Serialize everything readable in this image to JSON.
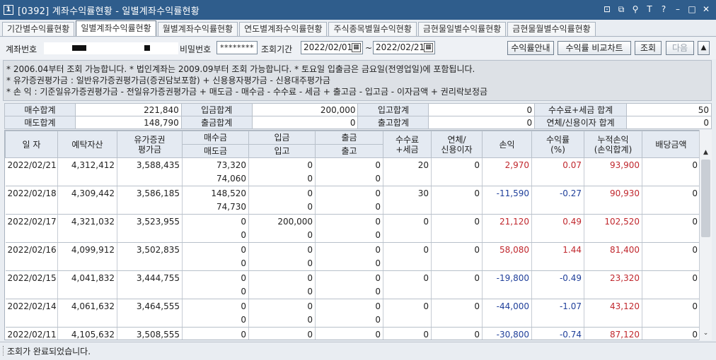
{
  "window": {
    "number": "1",
    "title": "[0392] 계좌수익률현황 - 일별계좌수익률현황",
    "icons": [
      "restore-window-icon",
      "copy-icon",
      "pin-icon",
      "font-icon",
      "help-icon",
      "minimize-icon",
      "maximize-icon",
      "close-icon"
    ],
    "icon_glyphs": [
      "⊡",
      "⧉",
      "⚲",
      "T",
      "?",
      "–",
      "□",
      "✕"
    ]
  },
  "tabs": [
    {
      "label": "기간별수익률현황",
      "active": false
    },
    {
      "label": "일별계좌수익률현황",
      "active": true
    },
    {
      "label": "월별계좌수익률현황",
      "active": false
    },
    {
      "label": "연도별계좌수익률현황",
      "active": false
    },
    {
      "label": "주식종목별월수익현황",
      "active": false
    },
    {
      "label": "금현물일별수익률현황",
      "active": false
    },
    {
      "label": "금현물월별수익률현황",
      "active": false
    }
  ],
  "search": {
    "account_label": "계좌번호",
    "password_label": "비밀번호",
    "password_value": "********",
    "period_label": "조회기간",
    "date_from": "2022/02/01",
    "date_sep": "~",
    "date_to": "2022/02/21",
    "calendar_glyph": "▦",
    "buttons": {
      "guide": "수익률안내",
      "compare": "수익률 비교차트",
      "query": "조회",
      "next": "다음",
      "collapse": "▲"
    }
  },
  "notes": [
    "* 2006.04부터 조회 가능합니다.   * 법인계좌는 2009.09부터 조회 가능합니다.   * 토요일 입출금은 금요일(전영업일)에 포함됩니다.",
    "* 유가증권평가금 : 일반유가증권평가금(증권담보포함) + 신용용자평가금 - 신용대주평가금",
    "* 손          익 : 기준일유가증권평가금 - 전일유가증권평가금 + 매도금 - 매수금 - 수수료 - 세금 + 출고금 - 입고금 - 이자금액 + 권리락보정금"
  ],
  "summary": {
    "row1": [
      {
        "label": "매수합계",
        "value": "221,840"
      },
      {
        "label": "입금합계",
        "value": "200,000"
      },
      {
        "label": "입고합계",
        "value": "0"
      },
      {
        "label": "수수료+세금 합계",
        "value": "50"
      }
    ],
    "row2": [
      {
        "label": "매도합계",
        "value": "148,790"
      },
      {
        "label": "출금합계",
        "value": "0"
      },
      {
        "label": "출고합계",
        "value": "0"
      },
      {
        "label": "연체/신용이자 합계",
        "value": "0"
      }
    ]
  },
  "grid": {
    "headers": {
      "date": "일 자",
      "deposit_assets": "예탁자산",
      "securities_eval_1": "유가증권",
      "securities_eval_2": "평가금",
      "buy": "매수금",
      "sell": "매도금",
      "deposit_in": "입금",
      "stock_in": "입고",
      "withdraw": "출금",
      "stock_out": "출고",
      "fee_1": "수수료",
      "fee_2": "+세금",
      "interest_1": "연체/",
      "interest_2": "신용이자",
      "pnl": "손익",
      "return_1": "수익률",
      "return_2": "(%)",
      "cum_pnl_1": "누적손익",
      "cum_pnl_2": "(손익합계)",
      "dividend": "배당금액"
    },
    "rows": [
      {
        "date": "2022/02/21",
        "assets": "4,312,412",
        "eval": "3,588,435",
        "buy": "73,320",
        "sell": "74,060",
        "dep": "0",
        "sin": "0",
        "wd": "0",
        "sout": "0",
        "fee": "20",
        "int": "0",
        "pnl": "2,970",
        "ret": "0.07",
        "cum": "93,900",
        "div": "0",
        "sign": "pos"
      },
      {
        "date": "2022/02/18",
        "assets": "4,309,442",
        "eval": "3,586,185",
        "buy": "148,520",
        "sell": "74,730",
        "dep": "0",
        "sin": "0",
        "wd": "0",
        "sout": "0",
        "fee": "30",
        "int": "0",
        "pnl": "-11,590",
        "ret": "-0.27",
        "cum": "90,930",
        "div": "0",
        "sign": "neg"
      },
      {
        "date": "2022/02/17",
        "assets": "4,321,032",
        "eval": "3,523,955",
        "buy": "0",
        "sell": "0",
        "dep": "200,000",
        "sin": "0",
        "wd": "0",
        "sout": "0",
        "fee": "0",
        "int": "0",
        "pnl": "21,120",
        "ret": "0.49",
        "cum": "102,520",
        "div": "0",
        "sign": "pos"
      },
      {
        "date": "2022/02/16",
        "assets": "4,099,912",
        "eval": "3,502,835",
        "buy": "0",
        "sell": "0",
        "dep": "0",
        "sin": "0",
        "wd": "0",
        "sout": "0",
        "fee": "0",
        "int": "0",
        "pnl": "58,080",
        "ret": "1.44",
        "cum": "81,400",
        "div": "0",
        "sign": "pos"
      },
      {
        "date": "2022/02/15",
        "assets": "4,041,832",
        "eval": "3,444,755",
        "buy": "0",
        "sell": "0",
        "dep": "0",
        "sin": "0",
        "wd": "0",
        "sout": "0",
        "fee": "0",
        "int": "0",
        "pnl": "-19,800",
        "ret": "-0.49",
        "cum": "23,320",
        "div": "0",
        "sign": "neg"
      },
      {
        "date": "2022/02/14",
        "assets": "4,061,632",
        "eval": "3,464,555",
        "buy": "0",
        "sell": "0",
        "dep": "0",
        "sin": "0",
        "wd": "0",
        "sout": "0",
        "fee": "0",
        "int": "0",
        "pnl": "-44,000",
        "ret": "-1.07",
        "cum": "43,120",
        "div": "0",
        "sign": "neg"
      },
      {
        "date": "2022/02/11",
        "assets": "4,105,632",
        "eval": "3,508,555",
        "buy": "0",
        "sell": "0",
        "dep": "0",
        "sin": "0",
        "wd": "0",
        "sout": "0",
        "fee": "0",
        "int": "0",
        "pnl": "-30,800",
        "ret": "-0.74",
        "cum": "87,120",
        "div": "0",
        "sign": "neg"
      }
    ]
  },
  "scroll": {
    "up": "▲",
    "down": "⌄"
  },
  "status": "조회가 완료되었습니다.",
  "colors": {
    "titlebar": "#2f5d8c",
    "positive": "#c0272d",
    "negative": "#1f3f9a"
  }
}
